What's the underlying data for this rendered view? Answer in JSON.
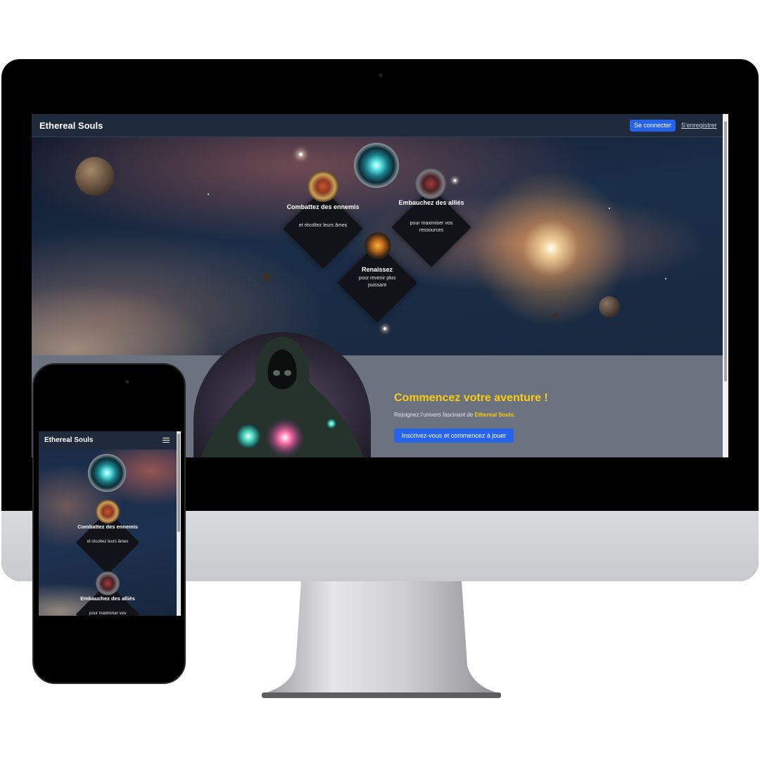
{
  "desktop": {
    "brand": "Ethereal Souls",
    "nav": {
      "login": "Se connecter",
      "register": "S'enregistrer"
    },
    "features": [
      {
        "title": "Combattez des ennemis",
        "subtitle": "et récoltez leurs âmes",
        "icon": "crossed-swords-medallion-icon"
      },
      {
        "title": "Embauchez des alliés",
        "subtitle": "pour maximiser vos ressources",
        "icon": "ally-portrait-medallion-icon"
      },
      {
        "title": "Renaissez",
        "subtitle": "pour revenir plus puissant",
        "icon": "phoenix-medallion-icon"
      }
    ],
    "top_icon": "soul-orb-medallion-icon",
    "cta": {
      "title": "Commencez votre aventure !",
      "text_prefix": "Rejoignez l'univers fascinant de ",
      "text_brand": "Ethereal Souls",
      "text_suffix": ".",
      "button": "Inscrivez-vous et commencez à jouer"
    }
  },
  "mobile": {
    "brand": "Ethereal Souls",
    "menu_icon": "hamburger-menu-icon",
    "features": [
      {
        "title": "Combattez des ennemis",
        "subtitle": "et récoltez leurs âmes"
      },
      {
        "title": "Embauchez des alliés",
        "subtitle": "pour maximiser vos"
      }
    ]
  },
  "colors": {
    "accent_blue": "#2563eb",
    "gold": "#facc15",
    "navbar": "#1f2a3c",
    "cta_bg": "#6b7280"
  }
}
